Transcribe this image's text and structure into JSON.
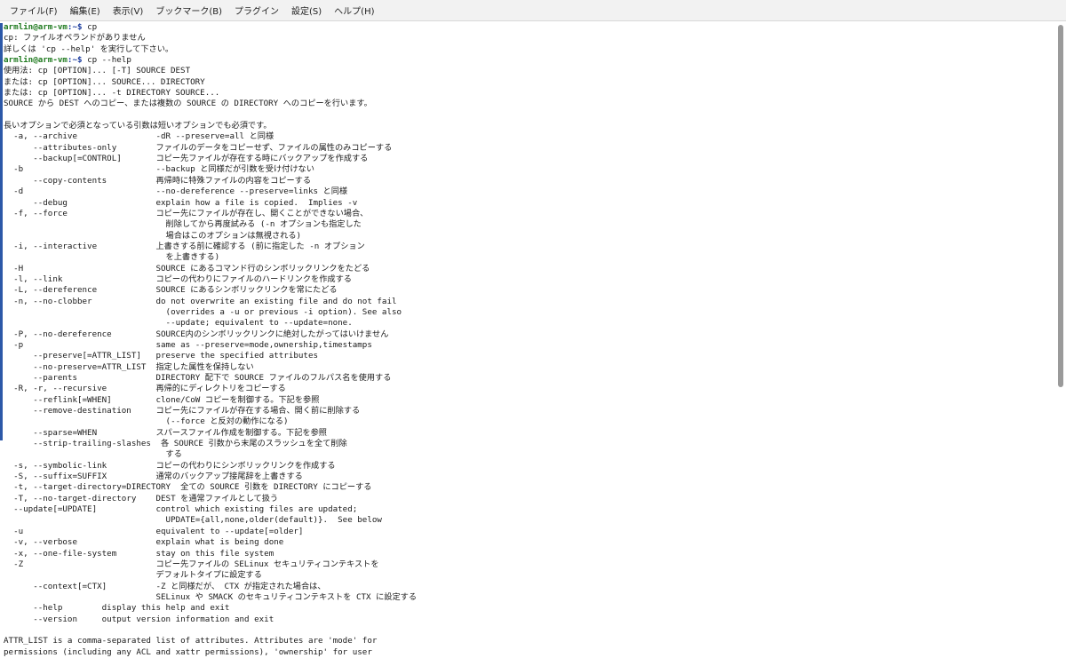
{
  "menu": [
    "ファイル(F)",
    "編集(E)",
    "表示(V)",
    "ブックマーク(B)",
    "プラグイン",
    "設定(S)",
    "ヘルプ(H)"
  ],
  "terminal": {
    "lines": [
      {
        "user": "armlin@arm-vm",
        "path": ":~$",
        "cmd": " cp"
      },
      {
        "text": "cp: ファイルオペランドがありません"
      },
      {
        "text": "詳しくは 'cp --help' を実行して下さい。"
      },
      {
        "user": "armlin@arm-vm",
        "path": ":~$",
        "cmd": " cp --help"
      },
      {
        "text": "使用法: cp [OPTION]... [-T] SOURCE DEST"
      },
      {
        "text": "または: cp [OPTION]... SOURCE... DIRECTORY"
      },
      {
        "text": "または: cp [OPTION]... -t DIRECTORY SOURCE..."
      },
      {
        "text": "SOURCE から DEST へのコピー、または複数の SOURCE の DIRECTORY へのコピーを行います。"
      },
      {
        "text": ""
      },
      {
        "text": "長いオプションで必須となっている引数は短いオプションでも必須です。"
      },
      {
        "text": "  -a, --archive                -dR --preserve=all と同様"
      },
      {
        "text": "      --attributes-only        ファイルのデータをコピーせず、ファイルの属性のみコピーする"
      },
      {
        "text": "      --backup[=CONTROL]       コピー先ファイルが存在する時にバックアップを作成する"
      },
      {
        "text": "  -b                           --backup と同様だが引数を受け付けない"
      },
      {
        "text": "      --copy-contents          再帰時に特殊ファイルの内容をコピーする"
      },
      {
        "text": "  -d                           --no-dereference --preserve=links と同様"
      },
      {
        "text": "      --debug                  explain how a file is copied.  Implies -v"
      },
      {
        "text": "  -f, --force                  コピー先にファイルが存在し、開くことができない場合、"
      },
      {
        "text": "                                 削除してから再度試みる (-n オプションも指定した"
      },
      {
        "text": "                                 場合はこのオプションは無視される)"
      },
      {
        "text": "  -i, --interactive            上書きする前に確認する (前に指定した -n オプション"
      },
      {
        "text": "                                 を上書きする)"
      },
      {
        "text": "  -H                           SOURCE にあるコマンド行のシンボリックリンクをたどる"
      },
      {
        "text": "  -l, --link                   コピーの代わりにファイルのハードリンクを作成する"
      },
      {
        "text": "  -L, --dereference            SOURCE にあるシンボリックリンクを常にたどる"
      },
      {
        "text": "  -n, --no-clobber             do not overwrite an existing file and do not fail"
      },
      {
        "text": "                                 (overrides a -u or previous -i option). See also"
      },
      {
        "text": "                                 --update; equivalent to --update=none."
      },
      {
        "text": "  -P, --no-dereference         SOURCE内のシンボリックリンクに絶対したがってはいけません"
      },
      {
        "text": "  -p                           same as --preserve=mode,ownership,timestamps"
      },
      {
        "text": "      --preserve[=ATTR_LIST]   preserve the specified attributes"
      },
      {
        "text": "      --no-preserve=ATTR_LIST  指定した属性を保持しない"
      },
      {
        "text": "      --parents                DIRECTORY 配下で SOURCE ファイルのフルパス名を使用する"
      },
      {
        "text": "  -R, -r, --recursive          再帰的にディレクトリをコピーする"
      },
      {
        "text": "      --reflink[=WHEN]         clone/CoW コピーを制御する。下記を参照"
      },
      {
        "text": "      --remove-destination     コピー先にファイルが存在する場合、開く前に削除する"
      },
      {
        "text": "                                 (--force と反対の動作になる)"
      },
      {
        "text": "      --sparse=WHEN            スパースファイル作成を制御する。下記を参照"
      },
      {
        "text": "      --strip-trailing-slashes  各 SOURCE 引数から末尾のスラッシュを全て削除"
      },
      {
        "text": "                                 する"
      },
      {
        "text": "  -s, --symbolic-link          コピーの代わりにシンボリックリンクを作成する"
      },
      {
        "text": "  -S, --suffix=SUFFIX          通常のバックアップ接尾辞を上書きする"
      },
      {
        "text": "  -t, --target-directory=DIRECTORY  全ての SOURCE 引数を DIRECTORY にコピーする"
      },
      {
        "text": "  -T, --no-target-directory    DEST を通常ファイルとして扱う"
      },
      {
        "text": "  --update[=UPDATE]            control which existing files are updated;"
      },
      {
        "text": "                                 UPDATE={all,none,older(default)}.  See below"
      },
      {
        "text": "  -u                           equivalent to --update[=older]"
      },
      {
        "text": "  -v, --verbose                explain what is being done"
      },
      {
        "text": "  -x, --one-file-system        stay on this file system"
      },
      {
        "text": "  -Z                           コピー先ファイルの SELinux セキュリティコンテキストを"
      },
      {
        "text": "                               デフォルトタイプに設定する"
      },
      {
        "text": "      --context[=CTX]          -Z と同様だが、 CTX が指定された場合は、"
      },
      {
        "text": "                               SELinux や SMACK のセキュリティコンテキストを CTX に設定する"
      },
      {
        "text": "      --help        display this help and exit"
      },
      {
        "text": "      --version     output version information and exit"
      },
      {
        "text": ""
      },
      {
        "text": "ATTR_LIST is a comma-separated list of attributes. Attributes are 'mode' for"
      },
      {
        "text": "permissions (including any ACL and xattr permissions), 'ownership' for user"
      }
    ]
  }
}
